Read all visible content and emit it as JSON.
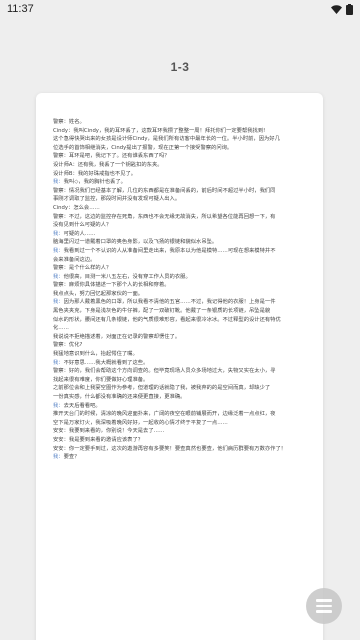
{
  "status_bar": {
    "time": "11:37"
  },
  "header": {
    "title": "1-3"
  },
  "document": {
    "lines": [
      "警察：姓名。",
      "Cindy：我叫Cindy，我的耳环丢了，这款耳环我攒了整整一周！拜托你们一定要帮我找到!",
      "这个急得快哭出来的女孩是设计师Cindy，是我们所有访客中最年长的一位。半小时前，因为好几",
      "位选手的首饰相继消失，Cindy提出了报警，现在正第一个接受警察的问询。",
      "警察：耳环是吧，我记下了。还有谁丢东西了吗？",
      "设计师A：还有我，我丢了一个钥匙扣的东夹。",
      "设计师B：我的好珠戒指也不见了。",
      "我：我叫◇，我的胸针也丢了。",
      "警察：情况我们已经基本了解，几位的东西都是在准备间丢的，前后时间不超过半小时，我们同",
      "事刚才调取了监控，那段时间并没有发现可疑人出入。",
      "Cindy：怎么会……",
      "警察：不过，这边的监控存在死角，东西也不会无缘无故消失，所以希望各位能再回想一下，有",
      "没有见到什么可疑的人？",
      "我：可疑的人……",
      "脑海里闪过一道戴着口罩的奥色身影，以及飞扬的银链和貌似水吊坠。",
      "我：我看到过一个不认识的人从准备间里走出来，我原本以为他是模特……可现在想来模特并不",
      "会来准备间这边。",
      "警察：是个什么样的人？",
      "我：他很高，目测一米八五左右，没有穿工作人员的衣服。",
      "警察：麻烦你具体描述一下那个人的长相和穿着。",
      "我点点头，努力回忆起那家伙的一面。",
      "我：因为那人戴着黑色的口罩，所以我看不清他的五官……不过，我记得他的衣服！上身是一件",
      "黑色夹夹克，下身是浅灰色的牛仔裤，配了一双破钉靴。他戴了一条银质的长项链，吊坠是貌",
      "似水的形状，腰间还有几条银链，他的气质很难形容，看起来很冷冰冰。不过释型的设计还有特优",
      "化……",
      "我说说不拒绝描述着，对面正在记录的警察却愣住了。",
      "警察：优化?",
      "我猛地意识到什么，抬起愕住了嘴。",
      "我：不好意思……我大概就看到了这些。",
      "警察：好的，我们会帮助这个方向调查的。但毕竟现场人员众多场地过大，失物又实在太小，寻",
      "找起来很有难度，你们要做好心理准备。",
      "之前那位会和上我宴空图作为参考，但道理的话就隐了我，被我弃的的是空间而真，却缺少了",
      "一份真实感，什么都没有准确的还来便更直接，更准确。",
      "我：去天后看看吧。",
      "推开天台门的时候，清凉的晚风迎面扑来，广阔的夜空在眼前铺展而开，边缘泛着一点点红，夜",
      "空下是万家灯火，我深吸着晚风好好，一起收的心情才终于平复了一点……",
      "安安：我要到来看的，你别说！今天是去了……",
      "安安：我是要到来看的邀请应该表了？",
      "安安：你一定要手到过，这次的遨游再容有多要笑！要查真然也要查，他们病历群要有万数亦作了！",
      "我：要查？"
    ]
  }
}
